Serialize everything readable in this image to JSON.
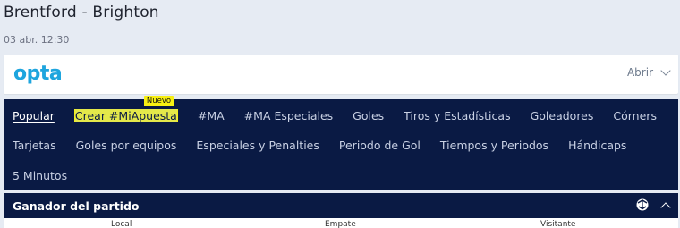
{
  "match": {
    "title": "Brentford - Brighton",
    "date": "03 abr. 12:30"
  },
  "opta": {
    "logo_text": "opta",
    "toggle_label": "Abrir",
    "logo_color": "#1ea5de"
  },
  "nav": {
    "badge": "Nuevo",
    "rows": [
      [
        "Popular",
        "Crear #MiApuesta",
        "#MA",
        "#MA Especiales",
        "Goles",
        "Tiros y Estadísticas",
        "Goleadores",
        "Córners"
      ],
      [
        "Tarjetas",
        "Goles por equipos",
        "Especiales y Penalties",
        "Periodo de Gol",
        "Tiempos y Periodos",
        "Hándicaps"
      ],
      [
        "5 Minutos"
      ]
    ]
  },
  "market": {
    "title": "Ganador del partido",
    "columns": [
      "Local",
      "Empate",
      "Visitante"
    ]
  },
  "colors": {
    "nav_bg": "#0a1a44",
    "highlight": "#f4f01c",
    "page_bg": "#e6ebf3"
  }
}
